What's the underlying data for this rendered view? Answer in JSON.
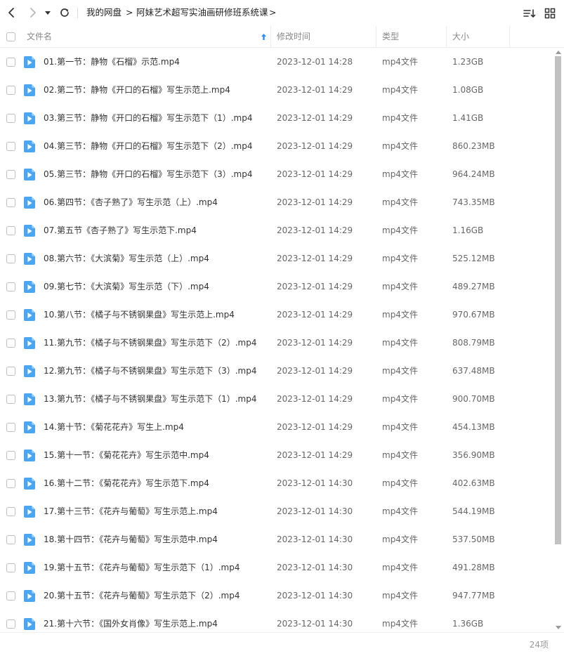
{
  "toolbar": {
    "back_icon": "chevron-left-icon",
    "forward_icon": "chevron-right-icon",
    "history_icon": "caret-down-icon",
    "refresh_icon": "refresh-icon",
    "breadcrumb": [
      "我的网盘",
      "阿妹艺术超写实油画研修班系统课"
    ],
    "separator": ">",
    "sort_icon": "sort-list-icon",
    "grid_icon": "grid-view-icon"
  },
  "header": {
    "name": "文件名",
    "modified": "修改时间",
    "type": "类型",
    "size": "大小",
    "sort_icon": "sort-arrow-up-icon",
    "sort_color": "#2b8cf7"
  },
  "colors": {
    "file_icon": "#4aa6f0"
  },
  "files": [
    {
      "name": "01.第一节：静物《石榴》示范.mp4",
      "modified": "2023-12-01 14:28",
      "type": "mp4文件",
      "size": "1.23GB"
    },
    {
      "name": "02.第二节：静物《开口的石榴》写生示范上.mp4",
      "modified": "2023-12-01 14:29",
      "type": "mp4文件",
      "size": "1.08GB"
    },
    {
      "name": "03.第三节：静物《开口的石榴》写生示范下（1）.mp4",
      "modified": "2023-12-01 14:29",
      "type": "mp4文件",
      "size": "1.41GB"
    },
    {
      "name": "04.第三节：静物《开口的石榴》写生示范下（2）.mp4",
      "modified": "2023-12-01 14:29",
      "type": "mp4文件",
      "size": "860.23MB"
    },
    {
      "name": "05.第三节：静物《开口的石榴》写生示范下（3）.mp4",
      "modified": "2023-12-01 14:29",
      "type": "mp4文件",
      "size": "964.24MB"
    },
    {
      "name": "06.第四节：《杏子熟了》写生示范（上）.mp4",
      "modified": "2023-12-01 14:29",
      "type": "mp4文件",
      "size": "743.35MB"
    },
    {
      "name": "07.第五节《杏子熟了》写生示范下.mp4",
      "modified": "2023-12-01 14:29",
      "type": "mp4文件",
      "size": "1.16GB"
    },
    {
      "name": "08.第六节：《大滨菊》写生示范（上）.mp4",
      "modified": "2023-12-01 14:29",
      "type": "mp4文件",
      "size": "525.12MB"
    },
    {
      "name": "09.第七节：《大滨菊》写生示范（下）.mp4",
      "modified": "2023-12-01 14:29",
      "type": "mp4文件",
      "size": "489.27MB"
    },
    {
      "name": "10.第八节：《橘子与不锈钢果盘》写生示范上.mp4",
      "modified": "2023-12-01 14:29",
      "type": "mp4文件",
      "size": "970.67MB"
    },
    {
      "name": "11.第九节：《橘子与不锈钢果盘》写生示范下（2）.mp4",
      "modified": "2023-12-01 14:29",
      "type": "mp4文件",
      "size": "808.79MB"
    },
    {
      "name": "12.第九节：《橘子与不锈钢果盘》写生示范下（3）.mp4",
      "modified": "2023-12-01 14:29",
      "type": "mp4文件",
      "size": "637.48MB"
    },
    {
      "name": "13.第九节：《橘子与不锈钢果盘》写生示范下（1）.mp4",
      "modified": "2023-12-01 14:29",
      "type": "mp4文件",
      "size": "900.70MB"
    },
    {
      "name": "14.第十节：《菊花花卉》写生上.mp4",
      "modified": "2023-12-01 14:29",
      "type": "mp4文件",
      "size": "454.13MB"
    },
    {
      "name": "15.第十一节：《菊花花卉》写生示范中.mp4",
      "modified": "2023-12-01 14:29",
      "type": "mp4文件",
      "size": "356.90MB"
    },
    {
      "name": "16.第十二节：《菊花花卉》写生示范下.mp4",
      "modified": "2023-12-01 14:30",
      "type": "mp4文件",
      "size": "402.63MB"
    },
    {
      "name": "17.第十三节：《花卉与葡萄》写生示范上.mp4",
      "modified": "2023-12-01 14:30",
      "type": "mp4文件",
      "size": "544.19MB"
    },
    {
      "name": "18.第十四节：《花卉与葡萄》写生示范中.mp4",
      "modified": "2023-12-01 14:30",
      "type": "mp4文件",
      "size": "537.50MB"
    },
    {
      "name": "19.第十五节：《花卉与葡萄》写生示范下（1）.mp4",
      "modified": "2023-12-01 14:30",
      "type": "mp4文件",
      "size": "491.28MB"
    },
    {
      "name": "20.第十五节：《花卉与葡萄》写生示范下（2）.mp4",
      "modified": "2023-12-01 14:30",
      "type": "mp4文件",
      "size": "947.77MB"
    },
    {
      "name": "21.第十六节：《国外女肖像》写生示范上.mp4",
      "modified": "2023-12-01 14:30",
      "type": "mp4文件",
      "size": "1.36GB"
    }
  ],
  "footer": {
    "count": "24项"
  }
}
